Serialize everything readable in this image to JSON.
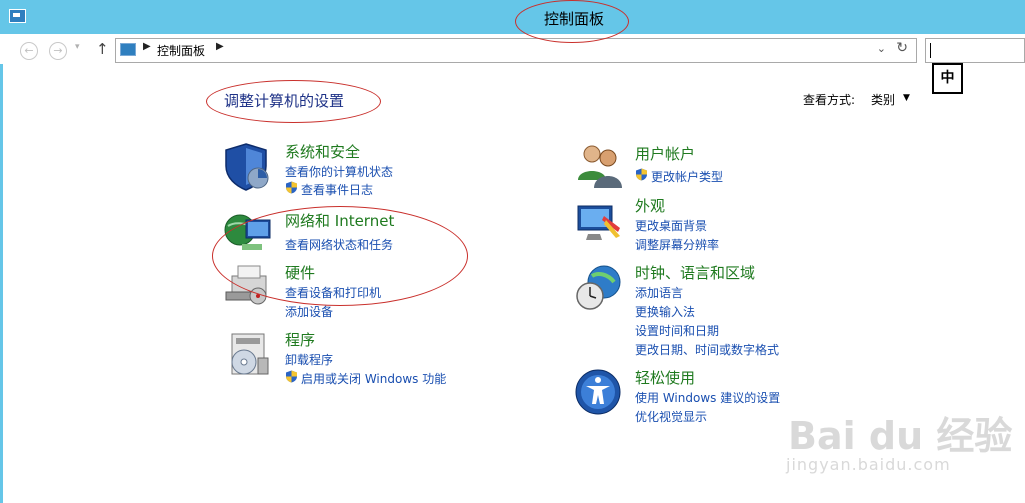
{
  "window": {
    "title": "控制面板"
  },
  "address_bar": {
    "path": [
      "控制面板"
    ]
  },
  "ime": {
    "label": "中"
  },
  "main": {
    "heading": "调整计算机的设置",
    "view": {
      "label": "查看方式:",
      "value": "类别"
    }
  },
  "categories_left": [
    {
      "title": "系统和安全",
      "icon": "system-security-icon",
      "links": [
        {
          "text": "查看你的计算机状态",
          "shield": false
        },
        {
          "text": "查看事件日志",
          "shield": true
        }
      ]
    },
    {
      "title": "网络和 Internet",
      "icon": "network-icon",
      "links": [
        {
          "text": "查看网络状态和任务",
          "shield": false
        }
      ]
    },
    {
      "title": "硬件",
      "icon": "hardware-icon",
      "links": [
        {
          "text": "查看设备和打印机",
          "shield": false
        },
        {
          "text": "添加设备",
          "shield": false
        }
      ]
    },
    {
      "title": "程序",
      "icon": "programs-icon",
      "links": [
        {
          "text": "卸载程序",
          "shield": false
        },
        {
          "text": "启用或关闭 Windows 功能",
          "shield": true
        }
      ]
    }
  ],
  "categories_right": [
    {
      "title": "用户帐户",
      "icon": "user-accounts-icon",
      "links": [
        {
          "text": "更改帐户类型",
          "shield": true
        }
      ]
    },
    {
      "title": "外观",
      "icon": "appearance-icon",
      "links": [
        {
          "text": "更改桌面背景",
          "shield": false
        },
        {
          "text": "调整屏幕分辨率",
          "shield": false
        }
      ]
    },
    {
      "title": "时钟、语言和区域",
      "icon": "clock-region-icon",
      "links": [
        {
          "text": "添加语言",
          "shield": false
        },
        {
          "text": "更换输入法",
          "shield": false
        },
        {
          "text": "设置时间和日期",
          "shield": false
        },
        {
          "text": "更改日期、时间或数字格式",
          "shield": false
        }
      ]
    },
    {
      "title": "轻松使用",
      "icon": "ease-of-access-icon",
      "links": [
        {
          "text": "使用 Windows 建议的设置",
          "shield": false
        },
        {
          "text": "优化视觉显示",
          "shield": false
        }
      ]
    }
  ],
  "watermark": {
    "brand": "Bai du 经验",
    "url": "jingyan.baidu.com"
  },
  "colors": {
    "titlebar": "#65c6e8",
    "link": "#1a4fb0",
    "category": "#1f7a1f",
    "heading": "#1e3287",
    "annotation": "#c9302c"
  }
}
